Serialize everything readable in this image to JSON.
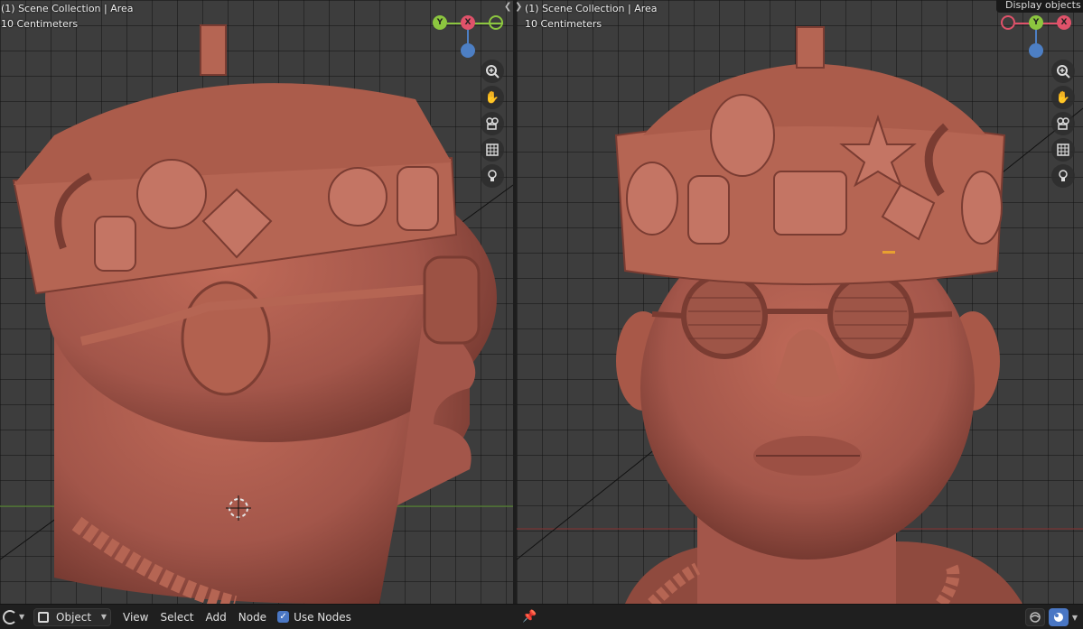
{
  "viewport_left": {
    "collection_label": "(1) Scene Collection | Area",
    "scale_label": "10 Centimeters",
    "gizmo": {
      "labels": [
        "Y",
        "X"
      ]
    }
  },
  "viewport_right": {
    "collection_label": "(1) Scene Collection | Area",
    "scale_label": "10 Centimeters",
    "gizmo": {
      "labels": [
        "Y",
        "X"
      ]
    },
    "tooltip": "Display objects w"
  },
  "nav_tools": [
    "zoom-icon",
    "pan-hand-icon",
    "camera-view-icon",
    "grid-toggle-icon",
    "light-bulb-icon"
  ],
  "footer": {
    "mode_label": "Object",
    "menus": [
      "View",
      "Select",
      "Add",
      "Node"
    ],
    "use_nodes_label": "Use Nodes",
    "use_nodes_checked": true
  },
  "colors": {
    "viewport_bg": "#3d3d3d",
    "grid_line": "#2f2f2f",
    "model_clay": "#a85848",
    "axis_y": "#8cc63f",
    "axis_x": "#e0526a",
    "axis_z": "#4d7fc4",
    "accent": "#4a77c4"
  }
}
